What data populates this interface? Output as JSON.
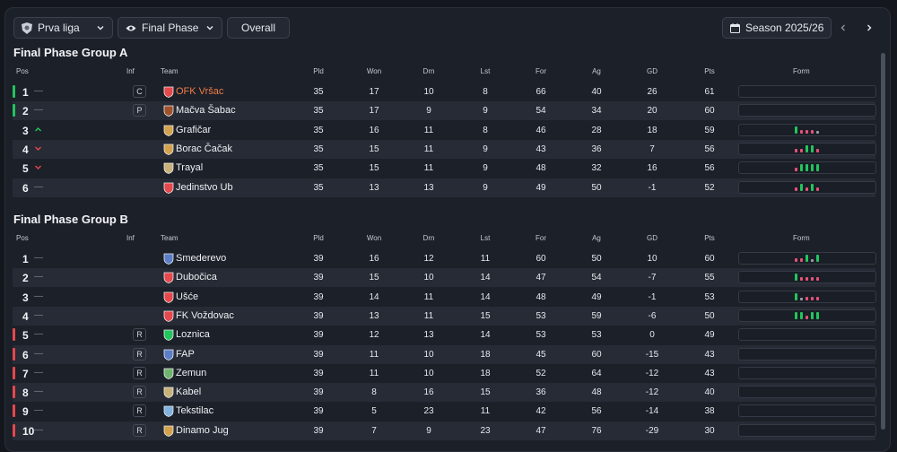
{
  "toolbar": {
    "competition": "Prva liga",
    "stage": "Final Phase",
    "view": "Overall",
    "season": "Season 2025/26"
  },
  "columns": {
    "pos": "Pos",
    "inf": "Inf",
    "team": "Team",
    "pld": "Pld",
    "won": "Won",
    "drn": "Drn",
    "lst": "Lst",
    "for": "For",
    "ag": "Ag",
    "gd": "GD",
    "pts": "Pts",
    "form": "Form"
  },
  "colors": {
    "promotion": "#22c55e",
    "relegation": "#e5484d",
    "champion": "#f07b4a",
    "form_win": "#22c55e",
    "form_draw": "#9aa0ab",
    "form_loss": "#e8527a"
  },
  "groups": [
    {
      "title": "Final Phase Group A",
      "rows": [
        {
          "pos": "1",
          "chg": "—",
          "inf": "C",
          "team": "OFK Vršac",
          "pld": "35",
          "won": "17",
          "drn": "10",
          "lst": "8",
          "for": "66",
          "ag": "40",
          "gd": "26",
          "pts": "61",
          "zone": "promotion",
          "highlight": true,
          "badge": "#e5484d",
          "form": []
        },
        {
          "pos": "2",
          "chg": "—",
          "inf": "P",
          "team": "Mačva Šabac",
          "pld": "35",
          "won": "17",
          "drn": "9",
          "lst": "9",
          "for": "54",
          "ag": "34",
          "gd": "20",
          "pts": "60",
          "zone": "promotion",
          "badge": "#a0522d",
          "form": []
        },
        {
          "pos": "3",
          "chg": "up",
          "inf": "",
          "team": "Grafičar",
          "pld": "35",
          "won": "16",
          "drn": "11",
          "lst": "8",
          "for": "46",
          "ag": "28",
          "gd": "18",
          "pts": "59",
          "zone": "",
          "badge": "#d4a24c",
          "form": [
            "W",
            "L",
            "L",
            "L",
            "D"
          ]
        },
        {
          "pos": "4",
          "chg": "down",
          "inf": "",
          "team": "Borac Čačak",
          "pld": "35",
          "won": "15",
          "drn": "11",
          "lst": "9",
          "for": "43",
          "ag": "36",
          "gd": "7",
          "pts": "56",
          "zone": "",
          "badge": "#d4a24c",
          "form": [
            "L",
            "L",
            "W",
            "W",
            "L"
          ]
        },
        {
          "pos": "5",
          "chg": "down",
          "inf": "",
          "team": "Trayal",
          "pld": "35",
          "won": "15",
          "drn": "11",
          "lst": "9",
          "for": "48",
          "ag": "32",
          "gd": "16",
          "pts": "56",
          "zone": "",
          "badge": "#c9b27a",
          "form": [
            "L",
            "W",
            "W",
            "W",
            "W"
          ]
        },
        {
          "pos": "6",
          "chg": "—",
          "inf": "",
          "team": "Jedinstvo Ub",
          "pld": "35",
          "won": "13",
          "drn": "13",
          "lst": "9",
          "for": "49",
          "ag": "50",
          "gd": "-1",
          "pts": "52",
          "zone": "",
          "badge": "#e5484d",
          "form": [
            "L",
            "W",
            "L",
            "W",
            "L"
          ]
        }
      ]
    },
    {
      "title": "Final Phase Group B",
      "rows": [
        {
          "pos": "1",
          "chg": "—",
          "inf": "",
          "team": "Smederevo",
          "pld": "39",
          "won": "16",
          "drn": "12",
          "lst": "11",
          "for": "60",
          "ag": "50",
          "gd": "10",
          "pts": "60",
          "zone": "",
          "badge": "#5b7ec9",
          "form": [
            "L",
            "L",
            "W",
            "D",
            "W"
          ]
        },
        {
          "pos": "2",
          "chg": "—",
          "inf": "",
          "team": "Dubočica",
          "pld": "39",
          "won": "15",
          "drn": "10",
          "lst": "14",
          "for": "47",
          "ag": "54",
          "gd": "-7",
          "pts": "55",
          "zone": "",
          "badge": "#e5484d",
          "form": [
            "W",
            "L",
            "L",
            "L",
            "L"
          ]
        },
        {
          "pos": "3",
          "chg": "—",
          "inf": "",
          "team": "Ušće",
          "pld": "39",
          "won": "14",
          "drn": "11",
          "lst": "14",
          "for": "48",
          "ag": "49",
          "gd": "-1",
          "pts": "53",
          "zone": "",
          "badge": "#e5484d",
          "form": [
            "W",
            "D",
            "L",
            "L",
            "L"
          ]
        },
        {
          "pos": "4",
          "chg": "—",
          "inf": "",
          "team": "FK Voždovac",
          "pld": "39",
          "won": "13",
          "drn": "11",
          "lst": "15",
          "for": "53",
          "ag": "59",
          "gd": "-6",
          "pts": "50",
          "zone": "",
          "badge": "#e5484d",
          "form": [
            "W",
            "W",
            "L",
            "W",
            "W"
          ]
        },
        {
          "pos": "5",
          "chg": "—",
          "inf": "R",
          "team": "Loznica",
          "pld": "39",
          "won": "12",
          "drn": "13",
          "lst": "14",
          "for": "53",
          "ag": "53",
          "gd": "0",
          "pts": "49",
          "zone": "relegation",
          "badge": "#22c55e",
          "form": []
        },
        {
          "pos": "6",
          "chg": "—",
          "inf": "R",
          "team": "FAP",
          "pld": "39",
          "won": "11",
          "drn": "10",
          "lst": "18",
          "for": "45",
          "ag": "60",
          "gd": "-15",
          "pts": "43",
          "zone": "relegation",
          "badge": "#5b7ec9",
          "form": []
        },
        {
          "pos": "7",
          "chg": "—",
          "inf": "R",
          "team": "Zemun",
          "pld": "39",
          "won": "11",
          "drn": "10",
          "lst": "18",
          "for": "52",
          "ag": "64",
          "gd": "-12",
          "pts": "43",
          "zone": "relegation",
          "badge": "#6fb36f",
          "form": []
        },
        {
          "pos": "8",
          "chg": "—",
          "inf": "R",
          "team": "Kabel",
          "pld": "39",
          "won": "8",
          "drn": "16",
          "lst": "15",
          "for": "36",
          "ag": "48",
          "gd": "-12",
          "pts": "40",
          "zone": "relegation",
          "badge": "#c9b27a",
          "form": []
        },
        {
          "pos": "9",
          "chg": "—",
          "inf": "R",
          "team": "Tekstilac",
          "pld": "39",
          "won": "5",
          "drn": "23",
          "lst": "11",
          "for": "42",
          "ag": "56",
          "gd": "-14",
          "pts": "38",
          "zone": "relegation",
          "badge": "#7fb3e0",
          "form": []
        },
        {
          "pos": "10",
          "chg": "—",
          "inf": "R",
          "team": "Dinamo Jug",
          "pld": "39",
          "won": "7",
          "drn": "9",
          "lst": "23",
          "for": "47",
          "ag": "76",
          "gd": "-29",
          "pts": "30",
          "zone": "relegation",
          "badge": "#d4a24c",
          "form": []
        }
      ]
    }
  ]
}
